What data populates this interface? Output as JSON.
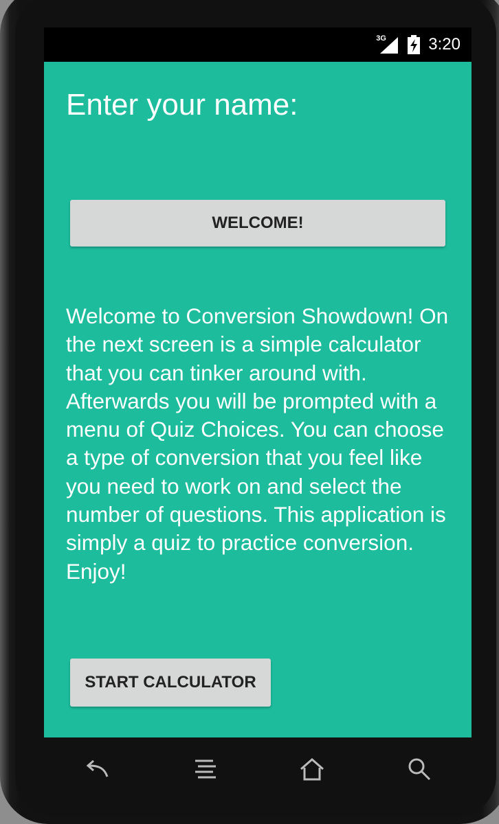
{
  "status_bar": {
    "network_type": "3G",
    "time": "3:20",
    "icons": [
      "signal-icon",
      "battery-charging-icon"
    ]
  },
  "main": {
    "prompt": "Enter your name:",
    "name_input": {
      "value": "",
      "placeholder": ""
    },
    "welcome_button": "WELCOME!",
    "description": "Welcome to Conversion Showdown! On the next screen is a simple calculator that you can tinker around with. Afterwards you will be prompted with a menu of Quiz Choices. You can choose a type of conversion that you feel like you need to work on and select the number of questions. This application is simply a quiz to practice conversion. Enjoy!",
    "start_button": "START CALCULATOR"
  },
  "nav_bar": {
    "icons": [
      "back-icon",
      "menu-icon",
      "home-icon",
      "search-icon"
    ]
  },
  "colors": {
    "screen_background": "#1dbc9c",
    "button_background": "#d6d7d7",
    "input_underline": "#0e7f6a",
    "status_bar": "#000000"
  }
}
